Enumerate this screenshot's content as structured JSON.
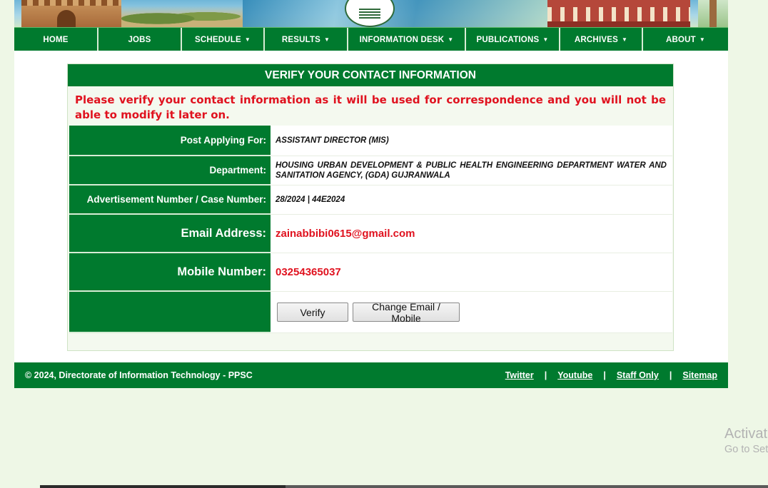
{
  "nav": {
    "items": [
      {
        "label": "HOME",
        "has_caret": false
      },
      {
        "label": "JOBS",
        "has_caret": false
      },
      {
        "label": "SCHEDULE",
        "has_caret": true
      },
      {
        "label": "RESULTS",
        "has_caret": true
      },
      {
        "label": "INFORMATION DESK",
        "has_caret": true
      },
      {
        "label": "PUBLICATIONS",
        "has_caret": true
      },
      {
        "label": "ARCHIVES",
        "has_caret": true
      },
      {
        "label": "ABOUT",
        "has_caret": true
      }
    ],
    "caret_glyph": "▼"
  },
  "panel": {
    "title": "VERIFY YOUR CONTACT INFORMATION",
    "notice": "Please verify your contact information as it will be used for correspondence and you will not be able to modify it later on.",
    "post_label": "Post Applying For:",
    "post_value": "ASSISTANT DIRECTOR (MIS)",
    "department_label": "Department:",
    "department_value": "HOUSING URBAN DEVELOPMENT & PUBLIC HEALTH ENGINEERING DEPARTMENT WATER AND SANITATION AGENCY, (GDA) GUJRANWALA",
    "advert_label": "Advertisement Number / Case Number:",
    "advert_value": "28/2024 | 44E2024",
    "email_label": "Email Address:",
    "email_value": "zainabbibi0615@gmail.com",
    "mobile_label": "Mobile Number:",
    "mobile_value": "03254365037",
    "verify_button": "Verify",
    "change_button": "Change Email / Mobile"
  },
  "footer": {
    "copyright": "© 2024, Directorate of Information Technology - PPSC",
    "links": [
      "Twitter",
      "Youtube",
      "Staff Only",
      "Sitemap"
    ],
    "separator": "|"
  },
  "watermark": {
    "title": "Activat",
    "subtitle": "Go to Set"
  },
  "colors": {
    "brand_green": "#007a2e",
    "alert_red": "#e0121f",
    "page_bg": "#eef7e6"
  }
}
